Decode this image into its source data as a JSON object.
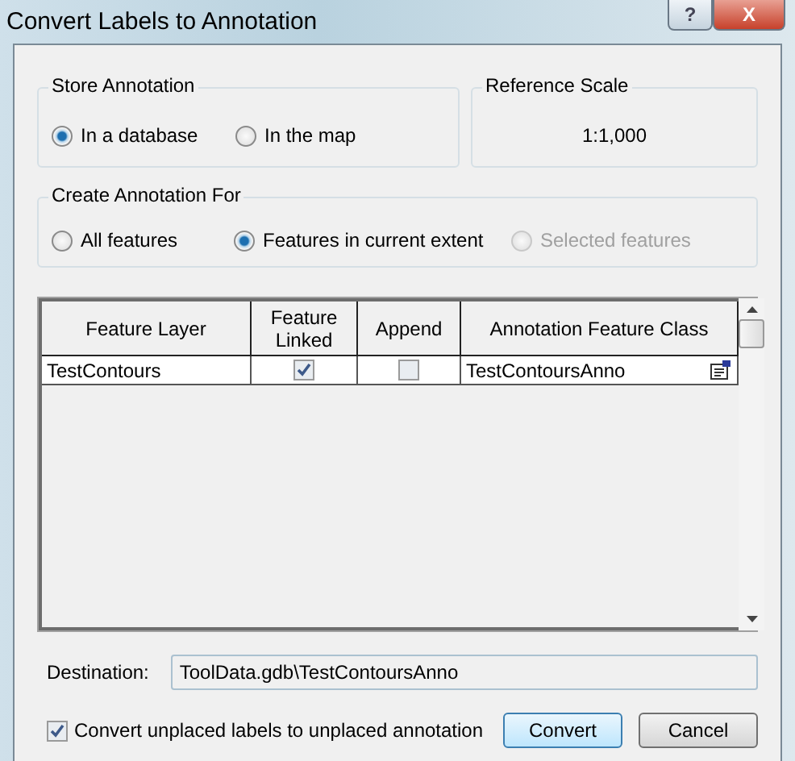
{
  "window": {
    "title": "Convert Labels to Annotation",
    "buttons": [
      {
        "kind": "help",
        "label": "?"
      },
      {
        "kind": "close",
        "label": "X"
      }
    ]
  },
  "store_annotation": {
    "title": "Store Annotation",
    "options": [
      {
        "label": "In a database",
        "selected": true,
        "disabled": false
      },
      {
        "label": "In the map",
        "selected": false,
        "disabled": false
      }
    ]
  },
  "reference_scale": {
    "title": "Reference Scale",
    "value": "1:1,000"
  },
  "create_annotation_for": {
    "title": "Create Annotation For",
    "options": [
      {
        "label": "All features",
        "selected": false,
        "disabled": false
      },
      {
        "label": "Features in current extent",
        "selected": true,
        "disabled": false
      },
      {
        "label": "Selected features",
        "selected": false,
        "disabled": true
      }
    ]
  },
  "table": {
    "columns": [
      "Feature Layer",
      "Feature Linked",
      "Append",
      "Annotation Feature Class"
    ],
    "rows": [
      {
        "feature_layer": "TestContours",
        "feature_linked": true,
        "append": false,
        "annotation_feature_class": "TestContoursAnno"
      }
    ]
  },
  "destination": {
    "label": "Destination:",
    "value": "ToolData.gdb\\TestContoursAnno"
  },
  "convert_unplaced": {
    "label": "Convert unplaced labels to unplaced annotation",
    "checked": true
  },
  "buttons": [
    {
      "label": "Convert",
      "default": true
    },
    {
      "label": "Cancel",
      "default": false
    }
  ]
}
